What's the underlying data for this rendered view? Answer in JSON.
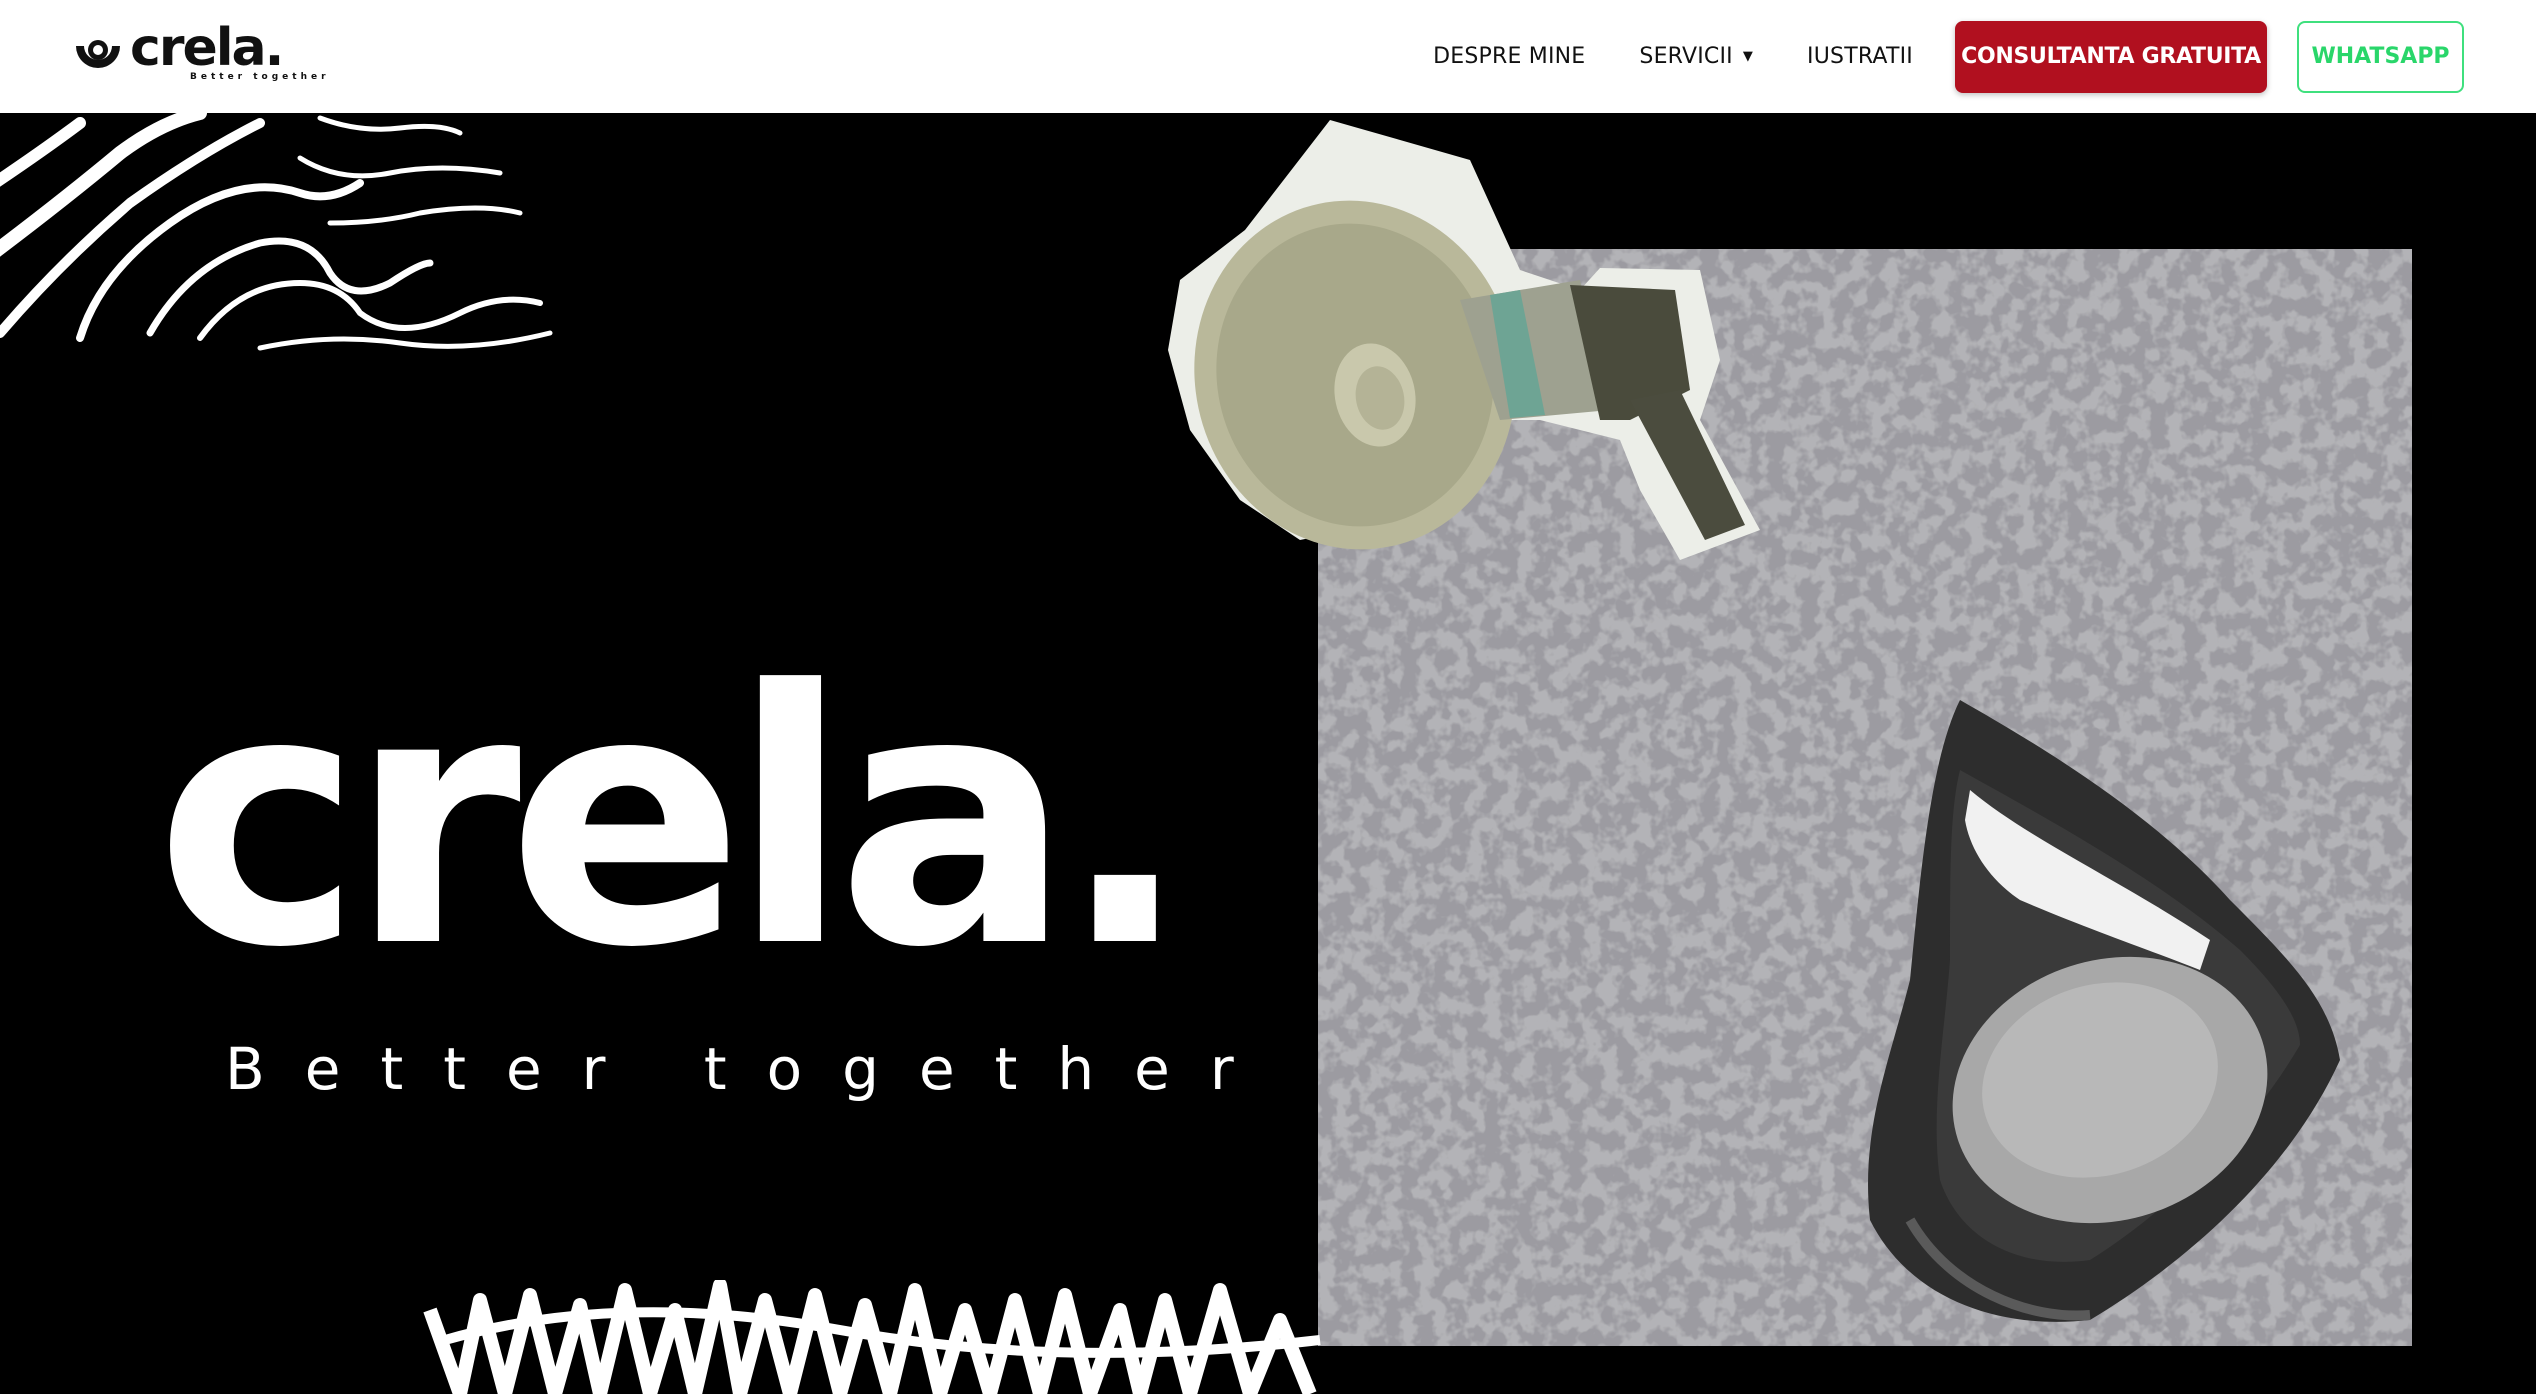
{
  "header": {
    "logo_icon": "crela-logo-mark",
    "logo_word": "crela.",
    "logo_tagline": "Better together"
  },
  "nav": {
    "items": [
      {
        "label": "DESPRE MINE"
      },
      {
        "label": "SERVICII",
        "icon": "caret-down-icon"
      },
      {
        "label": "IUSTRATII"
      }
    ],
    "cta_label": "CONSULTANTA GRATUITA",
    "whatsapp_label": "WHATSAPP"
  },
  "hero": {
    "title": "crela.",
    "tagline": "Better together"
  },
  "colors": {
    "cta_red": "#b1101f",
    "whatsapp_green": "#29d66a",
    "background": "#000000",
    "header_bg": "#ffffff"
  }
}
